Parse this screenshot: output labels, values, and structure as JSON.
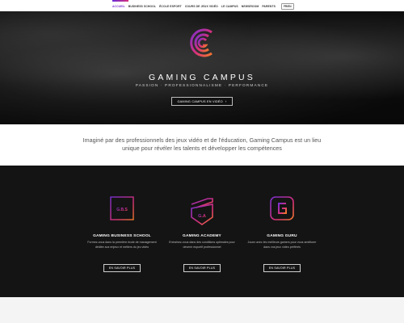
{
  "nav": {
    "items": [
      {
        "label": "ACCUEIL",
        "active": true
      },
      {
        "label": "BUSINESS SCHOOL",
        "active": false
      },
      {
        "label": "ÉCOLE ESPORT",
        "active": false
      },
      {
        "label": "COURS DE JEUX VIDÉO",
        "active": false
      },
      {
        "label": "LE CAMPUS",
        "active": false
      },
      {
        "label": "NEWSROOM",
        "active": false
      },
      {
        "label": "PARENTS",
        "active": false
      }
    ],
    "lang": "FR/EN"
  },
  "hero": {
    "title": "GAMING CAMPUS",
    "tagline": "PASSION · PROFESSIONNALISME · PERFORMANCE",
    "cta": "GAMING CAMPUS EN VIDÉO",
    "cta_icon": "arrow-right-icon"
  },
  "intro": {
    "text": "Imaginé par des professionnels des jeux vidéo et de l'éducation, Gaming Campus est un lieu unique pour révéler les talents et développer les compétences"
  },
  "schools": [
    {
      "name": "GAMING BUSINESS SCHOOL",
      "badge": "G.B.S",
      "description": "Formez-vous dans la première école de management dédiée aux enjeux et métiers du jeu vidéo",
      "button": "EN SAVOIR PLUS"
    },
    {
      "name": "GAMING ACADEMY",
      "badge": "G.A",
      "description": "Entraînez-vous dans des conditions optimales pour devenir esportif professionnel",
      "button": "EN SAVOIR PLUS"
    },
    {
      "name": "GAMING GURU",
      "badge": "G",
      "description": "Jouez avec les meilleurs gamers pour vous améliorer dans vos jeux vidéo préférés",
      "button": "EN SAVOIR PLUS"
    }
  ],
  "colors": {
    "accent_purple": "#7a2fd0",
    "accent_pink": "#d8307a",
    "accent_orange": "#f07a2a",
    "dark_bg": "#141414"
  }
}
